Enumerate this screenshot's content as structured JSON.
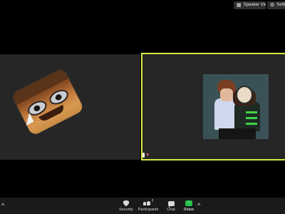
{
  "top": {
    "speaker_view_label": "Speaker View",
    "settings_label": "Settin"
  },
  "toolbar": {
    "security_label": "Security",
    "participants_label": "Participants",
    "participants_count": "2",
    "chat_label": "Chat",
    "share_label": "Share",
    "accent": "#23c04a"
  },
  "active_speaker_border": "#d9e93a"
}
